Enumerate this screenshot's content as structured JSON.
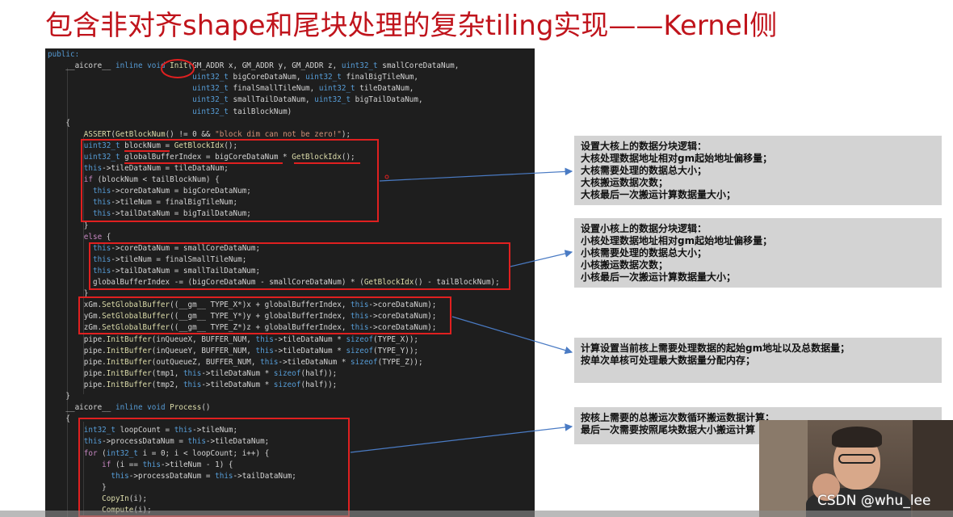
{
  "slide": {
    "title": "包含非对齐shape和尾块处理的复杂tiling实现——Kernel侧"
  },
  "code": {
    "lines": [
      [
        {
          "t": "public:",
          "c": "kw"
        }
      ],
      [
        {
          "t": "    __aicore__ ",
          "c": ""
        },
        {
          "t": "inline void ",
          "c": "kw"
        },
        {
          "t": "Init",
          "c": "fn"
        },
        {
          "t": "(GM_ADDR x, GM_ADDR y, GM_ADDR z, ",
          "c": ""
        },
        {
          "t": "uint32_t",
          "c": "kw"
        },
        {
          "t": " smallCoreDataNum,",
          "c": ""
        }
      ],
      [
        {
          "t": "                                ",
          "c": ""
        },
        {
          "t": "uint32_t",
          "c": "kw"
        },
        {
          "t": " bigCoreDataNum, ",
          "c": ""
        },
        {
          "t": "uint32_t",
          "c": "kw"
        },
        {
          "t": " finalBigTileNum,",
          "c": ""
        }
      ],
      [
        {
          "t": "                                ",
          "c": ""
        },
        {
          "t": "uint32_t",
          "c": "kw"
        },
        {
          "t": " finalSmallTileNum, ",
          "c": ""
        },
        {
          "t": "uint32_t",
          "c": "kw"
        },
        {
          "t": " tileDataNum,",
          "c": ""
        }
      ],
      [
        {
          "t": "                                ",
          "c": ""
        },
        {
          "t": "uint32_t",
          "c": "kw"
        },
        {
          "t": " smallTailDataNum, ",
          "c": ""
        },
        {
          "t": "uint32_t",
          "c": "kw"
        },
        {
          "t": " bigTailDataNum,",
          "c": ""
        }
      ],
      [
        {
          "t": "                                ",
          "c": ""
        },
        {
          "t": "uint32_t",
          "c": "kw"
        },
        {
          "t": " tailBlockNum)",
          "c": ""
        }
      ],
      [
        {
          "t": "    {",
          "c": ""
        }
      ],
      [
        {
          "t": "        ",
          "c": ""
        },
        {
          "t": "ASSERT",
          "c": "fn"
        },
        {
          "t": "(",
          "c": ""
        },
        {
          "t": "GetBlockNum",
          "c": "fn"
        },
        {
          "t": "() != 0 && ",
          "c": ""
        },
        {
          "t": "\"block dim can not be zero!\"",
          "c": "str"
        },
        {
          "t": ");",
          "c": ""
        }
      ],
      [
        {
          "t": "        ",
          "c": ""
        },
        {
          "t": "uint32_t",
          "c": "kw"
        },
        {
          "t": " blockNum = ",
          "c": ""
        },
        {
          "t": "GetBlockIdx",
          "c": "fn"
        },
        {
          "t": "();",
          "c": ""
        }
      ],
      [
        {
          "t": "        ",
          "c": ""
        },
        {
          "t": "uint32_t",
          "c": "kw"
        },
        {
          "t": " globalBufferIndex = bigCoreDataNum * ",
          "c": ""
        },
        {
          "t": "GetBlockIdx",
          "c": "fn"
        },
        {
          "t": "();",
          "c": ""
        }
      ],
      [
        {
          "t": "        ",
          "c": ""
        },
        {
          "t": "this",
          "c": "kw"
        },
        {
          "t": "->tileDataNum = tileDataNum;",
          "c": ""
        }
      ],
      [
        {
          "t": "        ",
          "c": ""
        },
        {
          "t": "if",
          "c": "ctl"
        },
        {
          "t": " (blockNum < tailBlockNum) {",
          "c": ""
        }
      ],
      [
        {
          "t": "          ",
          "c": ""
        },
        {
          "t": "this",
          "c": "kw"
        },
        {
          "t": "->coreDataNum = bigCoreDataNum;",
          "c": ""
        }
      ],
      [
        {
          "t": "          ",
          "c": ""
        },
        {
          "t": "this",
          "c": "kw"
        },
        {
          "t": "->tileNum = finalBigTileNum;",
          "c": ""
        }
      ],
      [
        {
          "t": "          ",
          "c": ""
        },
        {
          "t": "this",
          "c": "kw"
        },
        {
          "t": "->tailDataNum = bigTailDataNum;",
          "c": ""
        }
      ],
      [
        {
          "t": "        }",
          "c": ""
        }
      ],
      [
        {
          "t": "        ",
          "c": ""
        },
        {
          "t": "else",
          "c": "ctl"
        },
        {
          "t": " {",
          "c": ""
        }
      ],
      [
        {
          "t": "          ",
          "c": ""
        },
        {
          "t": "this",
          "c": "kw"
        },
        {
          "t": "->coreDataNum = smallCoreDataNum;",
          "c": ""
        }
      ],
      [
        {
          "t": "          ",
          "c": ""
        },
        {
          "t": "this",
          "c": "kw"
        },
        {
          "t": "->tileNum = finalSmallTileNum;",
          "c": ""
        }
      ],
      [
        {
          "t": "          ",
          "c": ""
        },
        {
          "t": "this",
          "c": "kw"
        },
        {
          "t": "->tailDataNum = smallTailDataNum;",
          "c": ""
        }
      ],
      [
        {
          "t": "          globalBufferIndex -= (bigCoreDataNum - smallCoreDataNum) * (",
          "c": ""
        },
        {
          "t": "GetBlockIdx",
          "c": "fn"
        },
        {
          "t": "() - tailBlockNum);",
          "c": ""
        }
      ],
      [
        {
          "t": "        }",
          "c": ""
        }
      ],
      [
        {
          "t": "        xGm.",
          "c": ""
        },
        {
          "t": "SetGlobalBuffer",
          "c": "fn"
        },
        {
          "t": "((__gm__ TYPE_X*)x + globalBufferIndex, ",
          "c": ""
        },
        {
          "t": "this",
          "c": "kw"
        },
        {
          "t": "->coreDataNum);",
          "c": ""
        }
      ],
      [
        {
          "t": "        yGm.",
          "c": ""
        },
        {
          "t": "SetGlobalBuffer",
          "c": "fn"
        },
        {
          "t": "((__gm__ TYPE_Y*)y + globalBufferIndex, ",
          "c": ""
        },
        {
          "t": "this",
          "c": "kw"
        },
        {
          "t": "->coreDataNum);",
          "c": ""
        }
      ],
      [
        {
          "t": "        zGm.",
          "c": ""
        },
        {
          "t": "SetGlobalBuffer",
          "c": "fn"
        },
        {
          "t": "((__gm__ TYPE_Z*)z + globalBufferIndex, ",
          "c": ""
        },
        {
          "t": "this",
          "c": "kw"
        },
        {
          "t": "->coreDataNum);",
          "c": ""
        }
      ],
      [
        {
          "t": "        pipe.",
          "c": ""
        },
        {
          "t": "InitBuffer",
          "c": "fn"
        },
        {
          "t": "(inQueueX, BUFFER_NUM, ",
          "c": ""
        },
        {
          "t": "this",
          "c": "kw"
        },
        {
          "t": "->tileDataNum * ",
          "c": ""
        },
        {
          "t": "sizeof",
          "c": "kw"
        },
        {
          "t": "(TYPE_X));",
          "c": ""
        }
      ],
      [
        {
          "t": "        pipe.",
          "c": ""
        },
        {
          "t": "InitBuffer",
          "c": "fn"
        },
        {
          "t": "(inQueueY, BUFFER_NUM, ",
          "c": ""
        },
        {
          "t": "this",
          "c": "kw"
        },
        {
          "t": "->tileDataNum * ",
          "c": ""
        },
        {
          "t": "sizeof",
          "c": "kw"
        },
        {
          "t": "(TYPE_Y));",
          "c": ""
        }
      ],
      [
        {
          "t": "        pipe.",
          "c": ""
        },
        {
          "t": "InitBuffer",
          "c": "fn"
        },
        {
          "t": "(outQueueZ, BUFFER_NUM, ",
          "c": ""
        },
        {
          "t": "this",
          "c": "kw"
        },
        {
          "t": "->tileDataNum * ",
          "c": ""
        },
        {
          "t": "sizeof",
          "c": "kw"
        },
        {
          "t": "(TYPE_Z));",
          "c": ""
        }
      ],
      [
        {
          "t": "        pipe.",
          "c": ""
        },
        {
          "t": "InitBuffer",
          "c": "fn"
        },
        {
          "t": "(tmp1, ",
          "c": ""
        },
        {
          "t": "this",
          "c": "kw"
        },
        {
          "t": "->tileDataNum * ",
          "c": ""
        },
        {
          "t": "sizeof",
          "c": "kw"
        },
        {
          "t": "(half));",
          "c": ""
        }
      ],
      [
        {
          "t": "        pipe.",
          "c": ""
        },
        {
          "t": "InitBuffer",
          "c": "fn"
        },
        {
          "t": "(tmp2, ",
          "c": ""
        },
        {
          "t": "this",
          "c": "kw"
        },
        {
          "t": "->tileDataNum * ",
          "c": ""
        },
        {
          "t": "sizeof",
          "c": "kw"
        },
        {
          "t": "(half));",
          "c": ""
        }
      ],
      [
        {
          "t": "    }",
          "c": ""
        }
      ],
      [
        {
          "t": "    __aicore__ ",
          "c": ""
        },
        {
          "t": "inline void ",
          "c": "kw"
        },
        {
          "t": "Process",
          "c": "fn"
        },
        {
          "t": "()",
          "c": ""
        }
      ],
      [
        {
          "t": "    {",
          "c": ""
        }
      ],
      [
        {
          "t": "        ",
          "c": ""
        },
        {
          "t": "int32_t",
          "c": "kw"
        },
        {
          "t": " loopCount = ",
          "c": ""
        },
        {
          "t": "this",
          "c": "kw"
        },
        {
          "t": "->tileNum;",
          "c": ""
        }
      ],
      [
        {
          "t": "        ",
          "c": ""
        },
        {
          "t": "this",
          "c": "kw"
        },
        {
          "t": "->processDataNum = ",
          "c": ""
        },
        {
          "t": "this",
          "c": "kw"
        },
        {
          "t": "->tileDataNum;",
          "c": ""
        }
      ],
      [
        {
          "t": "        ",
          "c": ""
        },
        {
          "t": "for",
          "c": "ctl"
        },
        {
          "t": " (",
          "c": ""
        },
        {
          "t": "int32_t",
          "c": "kw"
        },
        {
          "t": " i = 0; i < loopCount; i++) {",
          "c": ""
        }
      ],
      [
        {
          "t": "            ",
          "c": ""
        },
        {
          "t": "if",
          "c": "ctl"
        },
        {
          "t": " (i == ",
          "c": ""
        },
        {
          "t": "this",
          "c": "kw"
        },
        {
          "t": "->tileNum - 1) {",
          "c": ""
        }
      ],
      [
        {
          "t": "              ",
          "c": ""
        },
        {
          "t": "this",
          "c": "kw"
        },
        {
          "t": "->processDataNum = ",
          "c": ""
        },
        {
          "t": "this",
          "c": "kw"
        },
        {
          "t": "->tailDataNum;",
          "c": ""
        }
      ],
      [
        {
          "t": "            }",
          "c": ""
        }
      ],
      [
        {
          "t": "            ",
          "c": ""
        },
        {
          "t": "CopyIn",
          "c": "fn"
        },
        {
          "t": "(i);",
          "c": ""
        }
      ],
      [
        {
          "t": "            ",
          "c": ""
        },
        {
          "t": "Compute",
          "c": "fn"
        },
        {
          "t": "(i);",
          "c": ""
        }
      ]
    ]
  },
  "notes": [
    {
      "lines": [
        "设置大核上的数据分块逻辑：",
        "大核处理数据地址相对gm起始地址偏移量；",
        "大核需要处理的数据总大小；",
        "大核搬运数据次数；",
        "大核最后一次搬运计算数据量大小；"
      ]
    },
    {
      "lines": [
        "设置小核上的数据分块逻辑：",
        "小核处理数据地址相对gm起始地址偏移量；",
        "小核需要处理的数据总大小；",
        "小核搬运数据次数；",
        "小核最后一次搬运计算数据量大小；"
      ]
    },
    {
      "lines": [
        "计算设置当前核上需要处理数据的起始gm地址以及总数据量；",
        "按单次单核可处理最大数据量分配内存；"
      ]
    },
    {
      "lines": [
        "按核上需要的总搬运次数循环搬运数据计算；",
        "最后一次需要按照尾块数据大小搬运计算"
      ]
    }
  ],
  "watermark": "CSDN @whu_lee",
  "colors": {
    "title": "#c0141c",
    "highlight": "#e02020",
    "arrow": "#4a7bc4",
    "note_bg": "#d3d3d3"
  }
}
